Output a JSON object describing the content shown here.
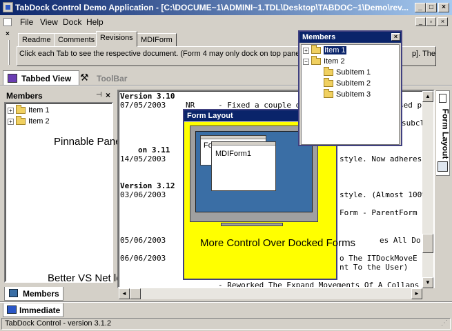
{
  "window": {
    "title": "TabDock Control Demo Application - [C:\\DOCUME~1\\ADMINI~1.TDL\\Desktop\\TABDOC~1\\Demo\\rev..."
  },
  "menu": [
    "File",
    "View",
    "Dock",
    "Help"
  ],
  "doc_tabs": [
    "Readme",
    "Comments",
    "Revisions",
    "MDIForm"
  ],
  "doc_tabs_active": "Revisions",
  "info_text": "Click each Tab to see the respective document. (Form 4 may only dock on top panel",
  "info_text_right": "p]. The",
  "toolbar_tabs": [
    "Tabbed View",
    "ToolBar"
  ],
  "members_panel": {
    "caption": "Members",
    "items": [
      "Item 1",
      "Item 2"
    ]
  },
  "labels": {
    "pinnable": "Pinnable Panel",
    "vsnet": "Better VS Net look",
    "more_control": "More Control Over Docked Forms"
  },
  "revisions": {
    "v310": "Version 3.10",
    "v310_date": "07/05/2003",
    "v310_nr": "NR",
    "v310_text": "- Fixed a couple of b",
    "v310_tail": "sed p",
    "subcl": "subcl",
    "v311": "on 3.11",
    "v311_date": "14/05/2003",
    "v311_tail": "style. Now adheres cl",
    "v312": "Version 3.12",
    "v312_date": "03/06/2003",
    "v312_tail": "style. (Almost 100%",
    "parentform": "Form - ParentForm -",
    "date_0506": "05/06/2003",
    "es_all": "es All Do",
    "date_0606": "06/06/2003",
    "idockmove": "o The ITDockMoveE",
    "to_user": "nt To the User)",
    "reworked": "-   Reworked The Expand Movements Of A Collaps"
  },
  "floating_members": {
    "title": "Members",
    "items": [
      "Item 1",
      "Item 2",
      "SubItem 1",
      "SubItem 2",
      "SubItem 3"
    ]
  },
  "form_layout": {
    "title": "Form Layout",
    "mdi_label": "MDIForm1",
    "fo_label": "Fo"
  },
  "right_tabs": [
    "Form Layout"
  ],
  "bottom_tabs": {
    "members": "Members",
    "immediate": "Immediate"
  },
  "status_text": "TabDock Control - version 3.1.2",
  "colors": {
    "title_active": "#0a246a",
    "highlight_yellow": "#ffff00",
    "form_layout_blue": "#3a6ea5"
  }
}
